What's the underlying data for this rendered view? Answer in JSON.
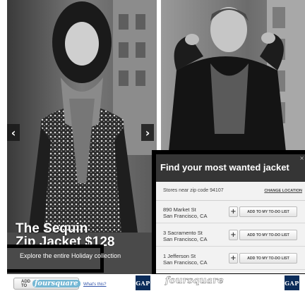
{
  "left_ad": {
    "headline_line1": "The Sequin",
    "headline_line2": "Zip Jacket $128",
    "explore_link": "Explore the entire Holiday collection",
    "prev_arrow": "‹",
    "next_arrow": "›",
    "add_button_label": "ADD TO",
    "foursquare_badge": "foursquare",
    "whats_this": "What's this?",
    "brand_logo": "GAP"
  },
  "right_ad": {
    "panel_title": "Find your most wanted jacket",
    "close_glyph": "×",
    "zip_text": "Stores near zip code 94107",
    "change_location": "CHANGE LOCATION",
    "stores": [
      {
        "street": "890 Market St",
        "city": "San Francisco, CA",
        "add_label": "+",
        "todo_label": "ADD TO MY TO-DO LIST"
      },
      {
        "street": "3 Sacramento St",
        "city": "San Francisco, CA",
        "add_label": "+",
        "todo_label": "ADD TO MY TO-DO LIST"
      },
      {
        "street": "1 Jefferson St",
        "city": "San Francisco, CA",
        "add_label": "+",
        "todo_label": "ADD TO MY TO-DO LIST"
      }
    ],
    "foursquare_logo": "foursquare",
    "brand_logo": "GAP"
  },
  "colors": {
    "panel_header": "#353535",
    "panel_frame": "#000000",
    "panel_body": "#f2f2f2",
    "foursquare_blue": "#74b7d4",
    "gap_navy": "#0b2c5a"
  },
  "icons": {
    "prev": "chevron-left-icon",
    "next": "chevron-right-icon",
    "close": "close-icon",
    "add": "plus-icon"
  }
}
